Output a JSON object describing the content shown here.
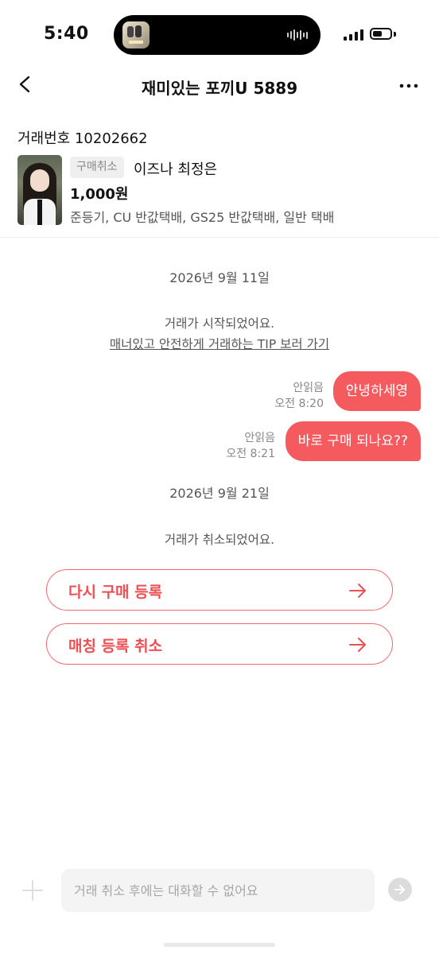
{
  "status_bar": {
    "time": "5:40",
    "battery_level": 0.55
  },
  "header": {
    "title": "재미있는 포끼U 5889",
    "back_icon": "chevron-left-icon",
    "more_icon": "more-horizontal-icon"
  },
  "trade": {
    "number_text": "거래번호 10202662",
    "badge": "구매취소",
    "product_name": "이즈나 최정은",
    "price": "1,000원",
    "shipping": "준등기, CU 반값택배, GS25 반값택배, 일반 택배"
  },
  "chat": {
    "date1": "2026년 9월 11일",
    "system_started": "거래가 시작되었어요.",
    "tip_link": "매너있고 안전하게 거래하는 TIP 보러 가기",
    "messages": [
      {
        "text": "안녕하세영",
        "status": "안읽음",
        "time": "오전 8:20"
      },
      {
        "text": "바로 구매 되나요??",
        "status": "안읽음",
        "time": "오전 8:21"
      }
    ],
    "date2": "2026년 9월 21일",
    "system_cancelled": "거래가 취소되었어요."
  },
  "actions": {
    "relist": "다시 구매 등록",
    "cancel_matching": "매칭 등록 취소"
  },
  "input": {
    "placeholder": "거래 취소 후에는 대화할 수 없어요",
    "plus_icon": "plus-icon",
    "send_icon": "send-arrow-icon"
  },
  "colors": {
    "accent": "#f45a5e",
    "accent_text": "#ee4f53",
    "badge_bg": "#efefef"
  }
}
